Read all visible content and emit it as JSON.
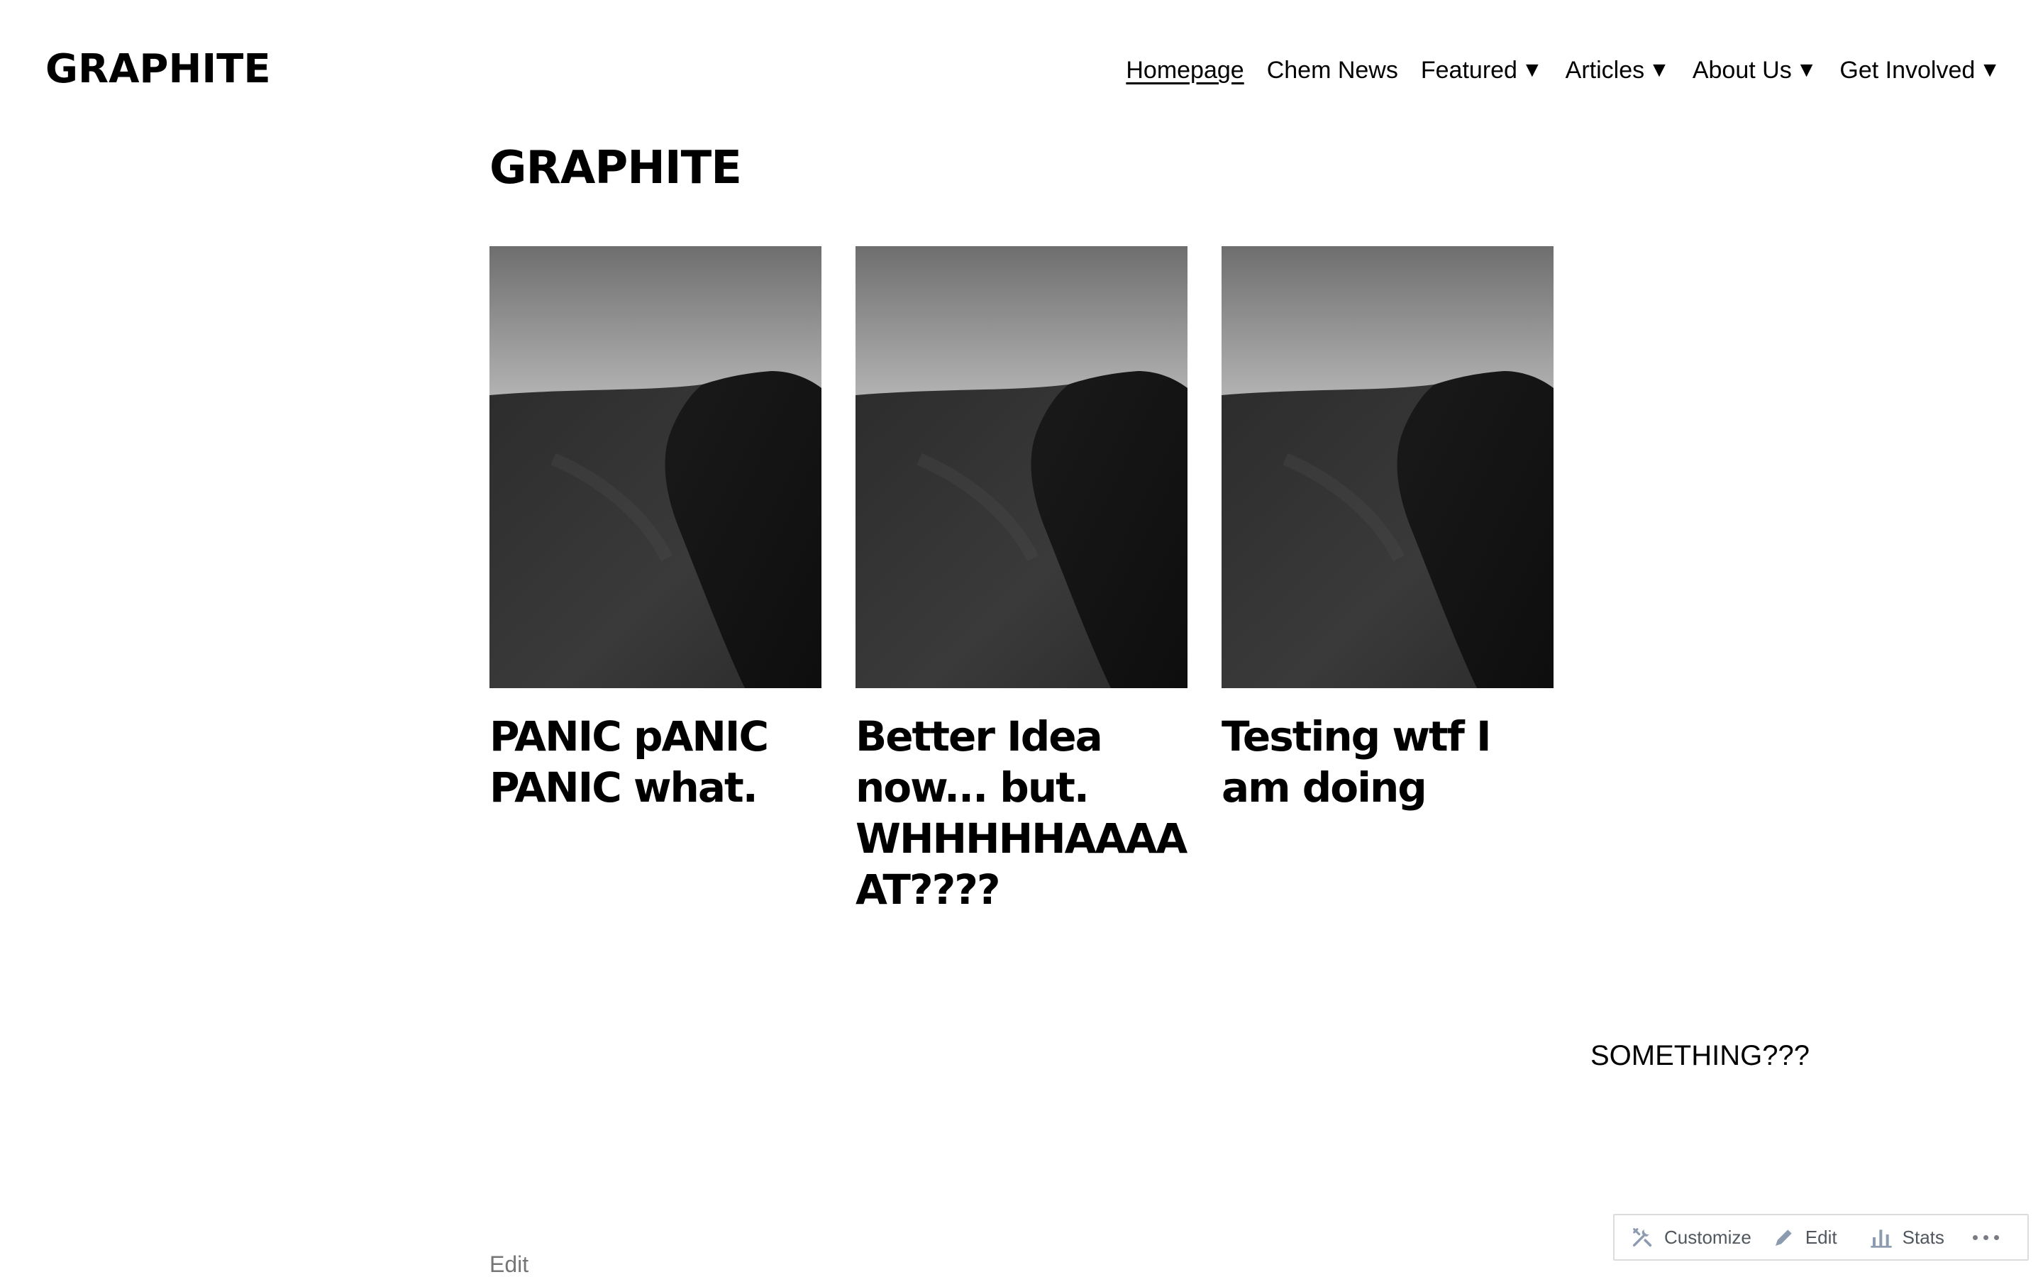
{
  "header": {
    "site_title": "GRAPHITE",
    "nav": [
      {
        "label": "Homepage",
        "current": true,
        "has_submenu": false
      },
      {
        "label": "Chem News",
        "current": false,
        "has_submenu": false
      },
      {
        "label": "Featured",
        "current": false,
        "has_submenu": true
      },
      {
        "label": "Articles",
        "current": false,
        "has_submenu": true
      },
      {
        "label": "About Us",
        "current": false,
        "has_submenu": true
      },
      {
        "label": "Get Involved",
        "current": false,
        "has_submenu": true
      }
    ],
    "submenu_caret": "▼"
  },
  "main": {
    "page_title": "GRAPHITE",
    "posts": [
      {
        "title": "PANIC pANIC PANIC what.",
        "image": "black-and-white-sand-dune"
      },
      {
        "title": "Better Idea now... but. WHHHHHAAAAAT????",
        "image": "black-and-white-sand-dune"
      },
      {
        "title": "Testing wtf I am doing",
        "image": "black-and-white-sand-dune"
      }
    ],
    "edit_link": "Edit"
  },
  "sidebar": {
    "text": "SOMETHING???"
  },
  "admin_bar": {
    "customize_label": "Customize",
    "edit_label": "Edit",
    "stats_label": "Stats",
    "icons": [
      "customize-icon",
      "pencil-icon",
      "stats-bar-icon",
      "more-dots-icon"
    ],
    "icon_color": "#8c9bb0"
  }
}
